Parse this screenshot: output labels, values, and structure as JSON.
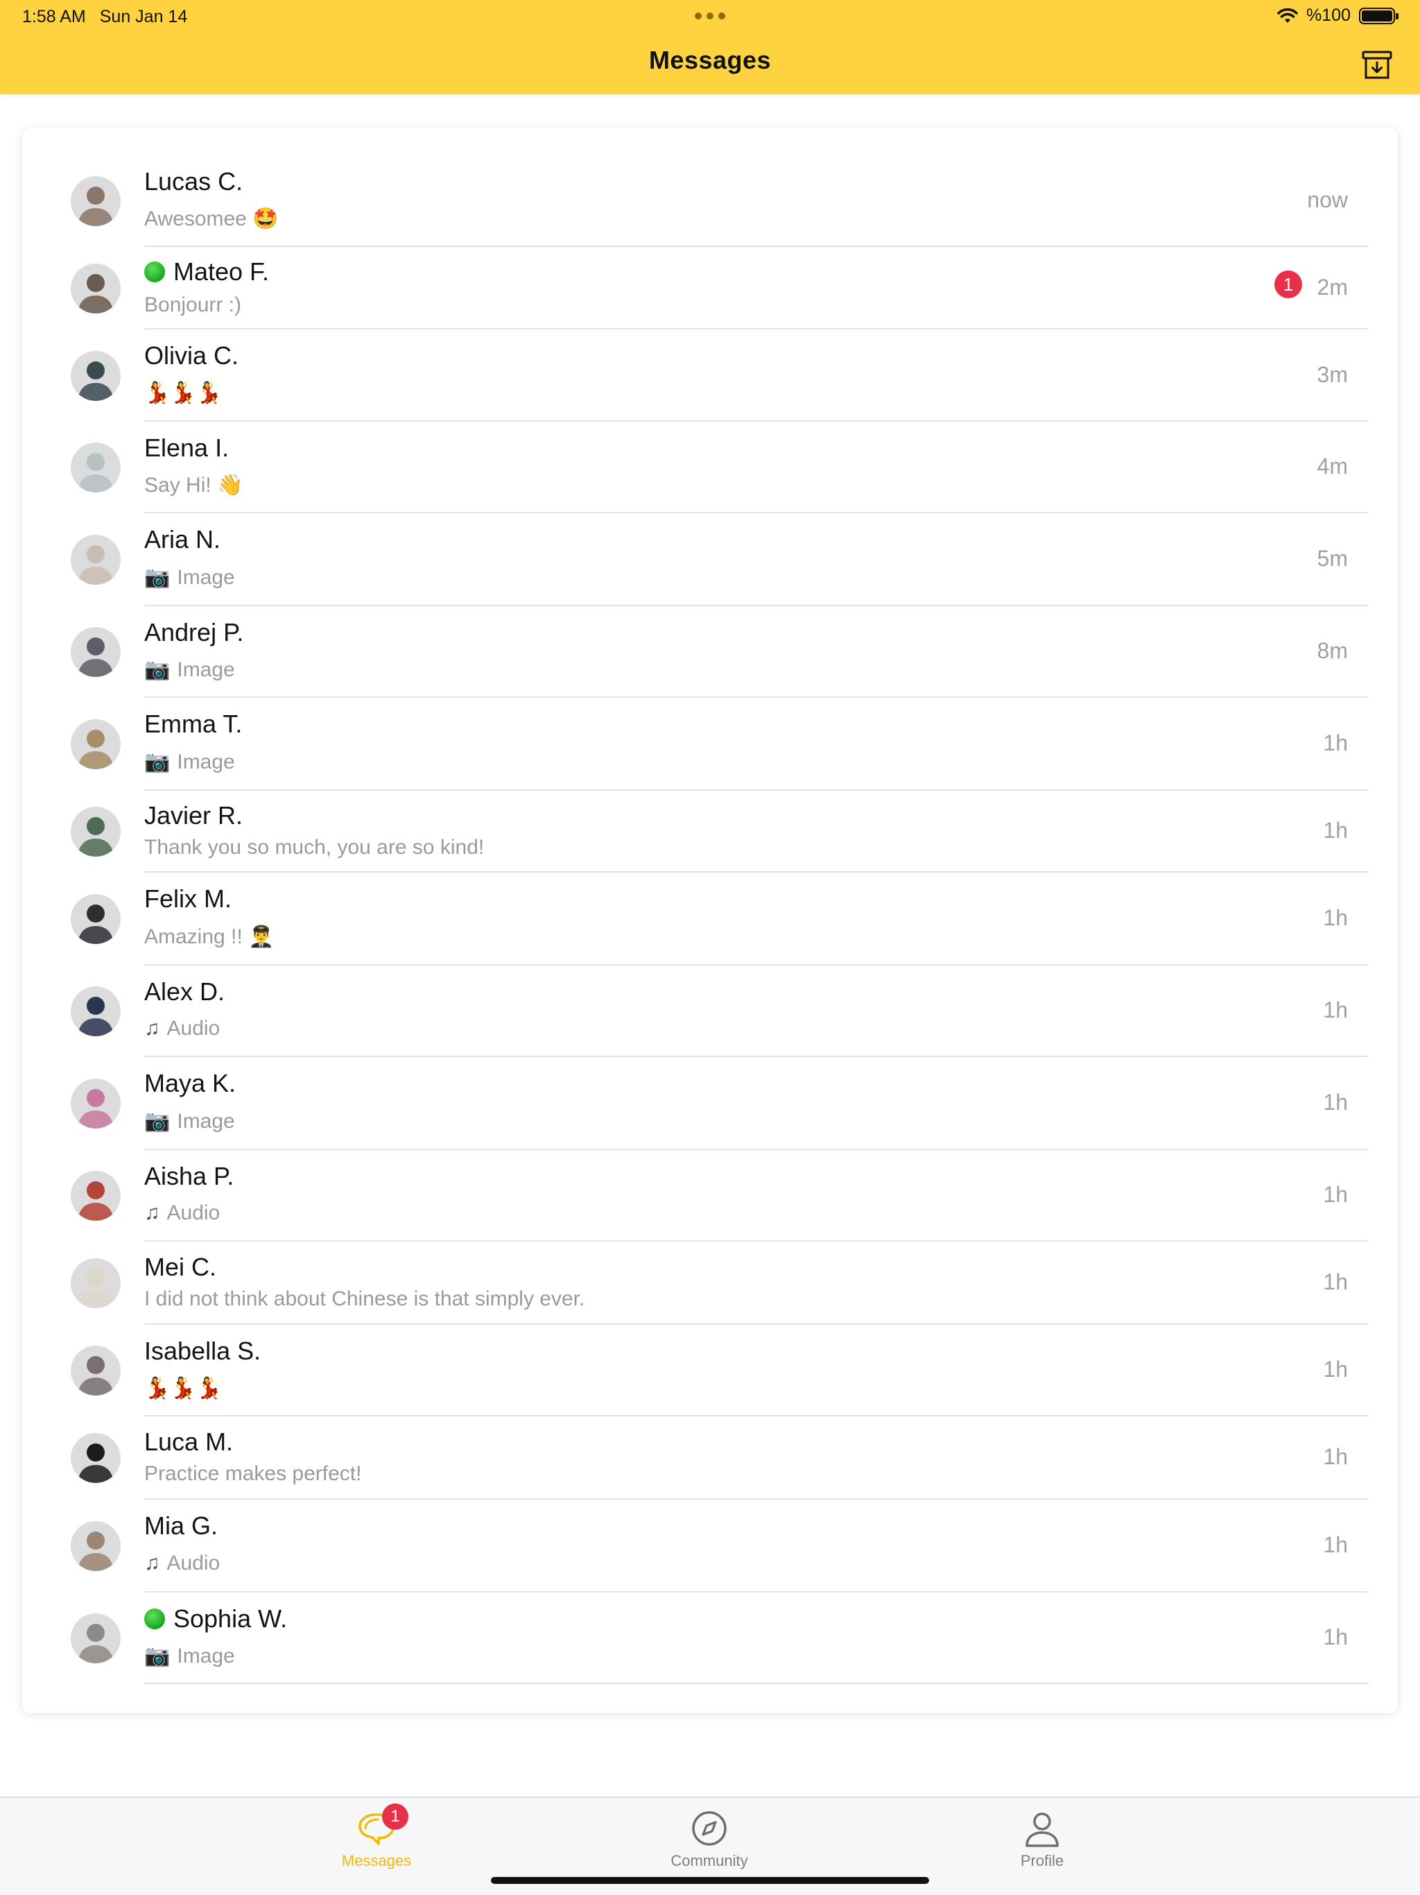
{
  "status_bar": {
    "time": "1:58 AM",
    "date": "Sun Jan 14",
    "battery_text": "%100"
  },
  "header": {
    "title": "Messages",
    "archive_icon": "archive-down-icon",
    "background": "#ffd23f"
  },
  "conversations": [
    {
      "name": "Lucas C.",
      "preview": "Awesomee 🤩",
      "preview_icon": "",
      "time": "now",
      "unread": "",
      "online": false,
      "avatar_color": "#8a7767"
    },
    {
      "name": "Mateo F.",
      "preview": "Bonjourr :)",
      "preview_icon": "",
      "time": "2m",
      "unread": "1",
      "online": true,
      "avatar_color": "#6b5a4e"
    },
    {
      "name": "Olivia C.",
      "preview": "💃💃💃",
      "preview_icon": "",
      "time": "3m",
      "unread": "",
      "online": false,
      "avatar_color": "#3c4a52"
    },
    {
      "name": "Elena I.",
      "preview": "Say Hi! 👋",
      "preview_icon": "",
      "time": "4m",
      "unread": "",
      "online": false,
      "avatar_color": "#b7c0c4"
    },
    {
      "name": "Aria N.",
      "preview": "Image",
      "preview_icon": "📷",
      "time": "5m",
      "unread": "",
      "online": false,
      "avatar_color": "#c9bdb3"
    },
    {
      "name": "Andrej P.",
      "preview": "Image",
      "preview_icon": "📷",
      "time": "8m",
      "unread": "",
      "online": false,
      "avatar_color": "#5b5f66"
    },
    {
      "name": "Emma T.",
      "preview": "Image",
      "preview_icon": "📷",
      "time": "1h",
      "unread": "",
      "online": false,
      "avatar_color": "#a88d66"
    },
    {
      "name": "Javier R.",
      "preview": "Thank you so much, you are so kind!",
      "preview_icon": "",
      "time": "1h",
      "unread": "",
      "online": false,
      "avatar_color": "#4f6b55"
    },
    {
      "name": "Felix M.",
      "preview": "Amazing !! 👨‍✈️",
      "preview_icon": "",
      "time": "1h",
      "unread": "",
      "online": false,
      "avatar_color": "#2d2f33"
    },
    {
      "name": "Alex D.",
      "preview": "Audio",
      "preview_icon": "♫",
      "time": "1h",
      "unread": "",
      "online": false,
      "avatar_color": "#2a3550"
    },
    {
      "name": "Maya K.",
      "preview": "Image",
      "preview_icon": "📷",
      "time": "1h",
      "unread": "",
      "online": false,
      "avatar_color": "#c77a9c"
    },
    {
      "name": "Aisha P.",
      "preview": "Audio",
      "preview_icon": "♫",
      "time": "1h",
      "unread": "",
      "online": false,
      "avatar_color": "#b4443a"
    },
    {
      "name": "Mei C.",
      "preview": "I did not think about Chinese is that simply ever.",
      "preview_icon": "",
      "time": "1h",
      "unread": "",
      "online": false,
      "avatar_color": "#ddd6cc"
    },
    {
      "name": "Isabella S.",
      "preview": "💃💃💃",
      "preview_icon": "",
      "time": "1h",
      "unread": "",
      "online": false,
      "avatar_color": "#7a6f72"
    },
    {
      "name": "Luca M.",
      "preview": "Practice makes perfect!",
      "preview_icon": "",
      "time": "1h",
      "unread": "",
      "online": false,
      "avatar_color": "#1e1b19"
    },
    {
      "name": "Mia G.",
      "preview": "Audio",
      "preview_icon": "♫",
      "time": "1h",
      "unread": "",
      "online": false,
      "avatar_color": "#9b8573"
    },
    {
      "name": "Sophia W.",
      "preview": "Image",
      "preview_icon": "📷",
      "time": "1h",
      "unread": "",
      "online": true,
      "avatar_color": "#8e8a86"
    }
  ],
  "tabbar": {
    "tabs": [
      {
        "label": "Messages",
        "icon": "chat-bubbles-icon",
        "badge": "1",
        "active": true
      },
      {
        "label": "Community",
        "icon": "compass-icon",
        "badge": "",
        "active": false
      },
      {
        "label": "Profile",
        "icon": "person-icon",
        "badge": "",
        "active": false
      }
    ],
    "active_color": "#f5b800"
  }
}
